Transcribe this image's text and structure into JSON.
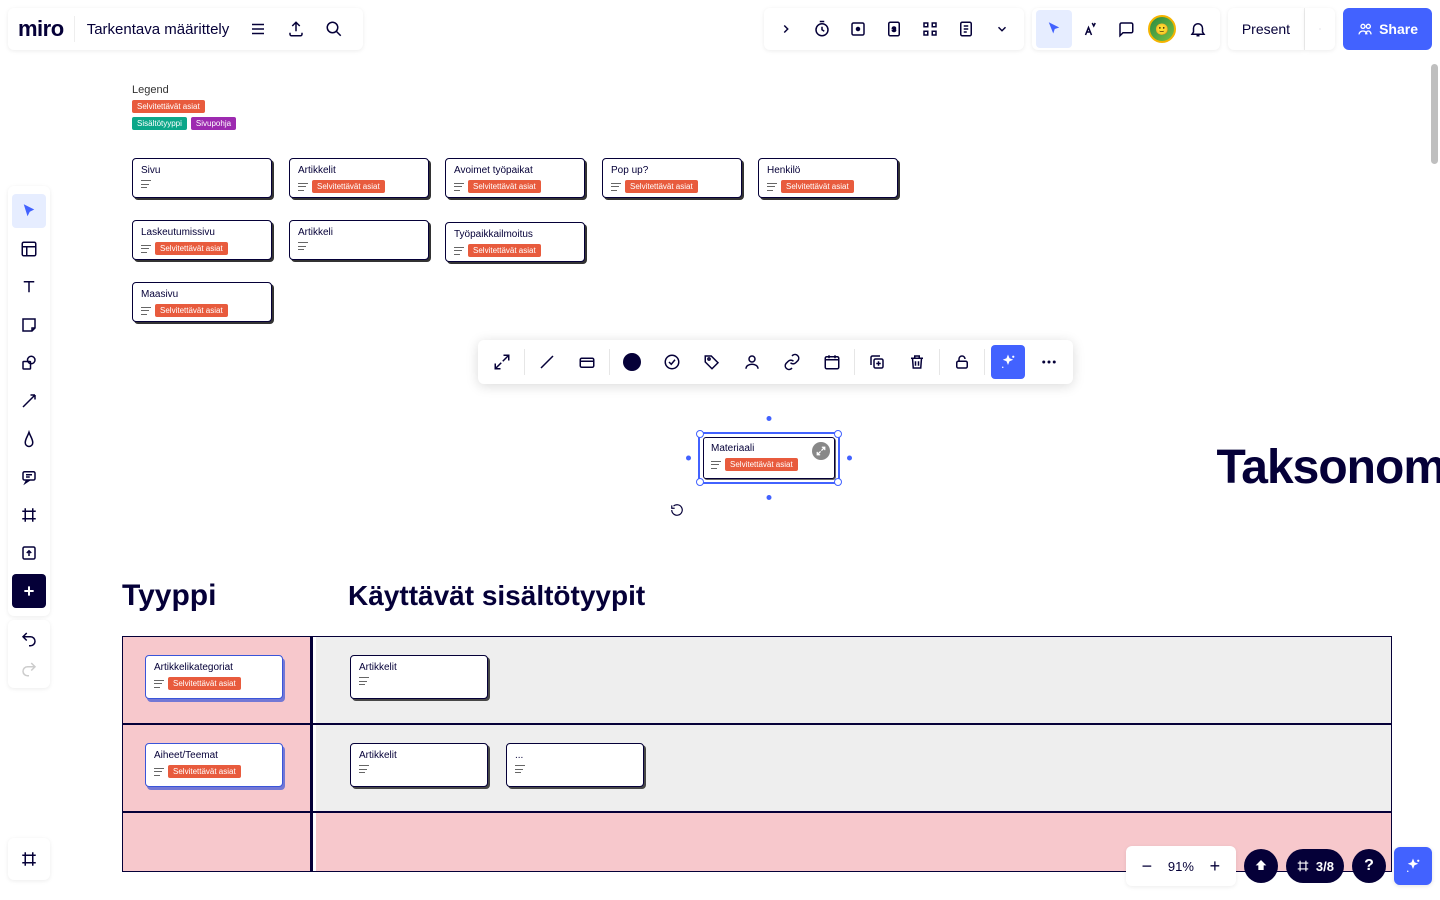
{
  "header": {
    "logo": "miro",
    "board_title": "Tarkentava määrittely",
    "present": "Present",
    "share": "Share"
  },
  "legend": {
    "title": "Legend",
    "tags": [
      "Selvitettävät asiat",
      "Sisältötyyppi",
      "Sivupohja"
    ]
  },
  "cards": {
    "sivu": "Sivu",
    "artikkelit": "Artikkelit",
    "avoimet": "Avoimet työpaikat",
    "popup": "Pop up?",
    "henkilo": "Henkilö",
    "laskeutumis": "Laskeutumissivu",
    "artikkeli": "Artikkeli",
    "tyopaikka": "Työpaikkailmoitus",
    "maasivu": "Maasivu",
    "materiaali": "Materiaali",
    "tag_orange": "Selvitettävät asiat"
  },
  "headings": {
    "takso": "Taksonom",
    "tyyppi": "Tyyppi",
    "kaytt": "Käyttävät sisältötyypit"
  },
  "table": {
    "artikkelikat": "Artikkelikategoriat",
    "aiheet": "Aiheet/Teemat",
    "artikkelit": "Artikkelit",
    "ellipsis": "..."
  },
  "footer": {
    "zoom": "91%",
    "frames": "3/8"
  }
}
